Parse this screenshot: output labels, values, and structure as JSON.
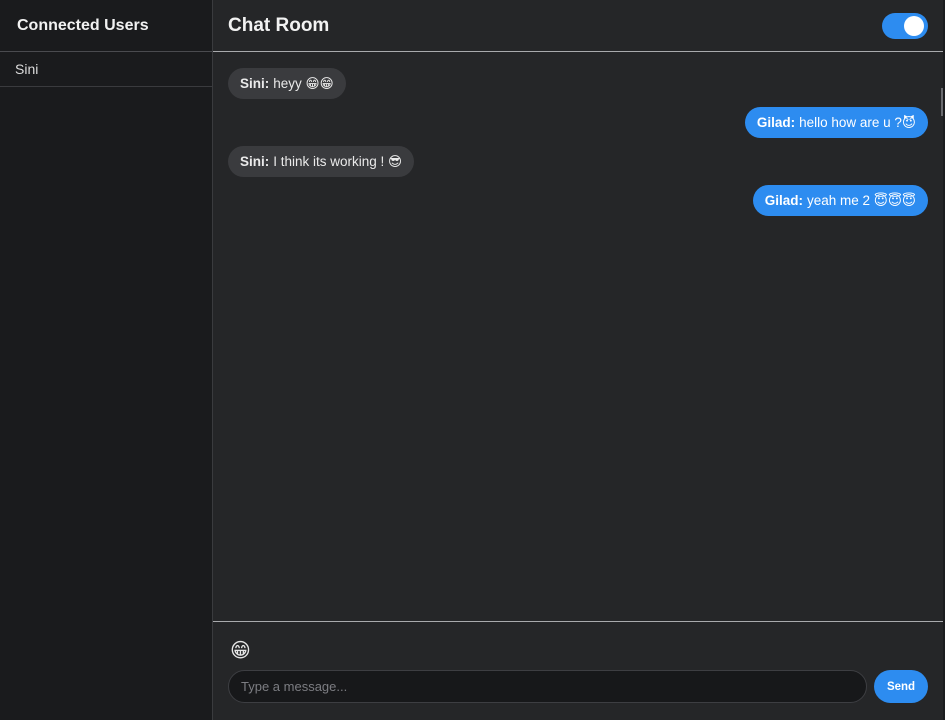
{
  "sidebar": {
    "title": "Connected Users",
    "users": [
      {
        "name": "Sini"
      }
    ]
  },
  "header": {
    "title": "Chat Room",
    "dark_mode_toggle": {
      "on": true
    }
  },
  "messages": [
    {
      "side": "left",
      "sender": "Sini:",
      "text": "heyy 😁😁"
    },
    {
      "side": "right",
      "sender": "Gilad:",
      "text": "hello how are u ?😈"
    },
    {
      "side": "left",
      "sender": "Sini:",
      "text": "I think its working ! 😎"
    },
    {
      "side": "right",
      "sender": "Gilad:",
      "text": "yeah me 2 😇😇😇"
    }
  ],
  "composer": {
    "emoji": "😁",
    "placeholder": "Type a message...",
    "value": "",
    "send_label": "Send"
  },
  "colors": {
    "accent": "#2d8cf0",
    "sidebar_bg": "#1a1b1d",
    "main_bg": "#252628",
    "bubble_other": "#3a3b3e"
  }
}
